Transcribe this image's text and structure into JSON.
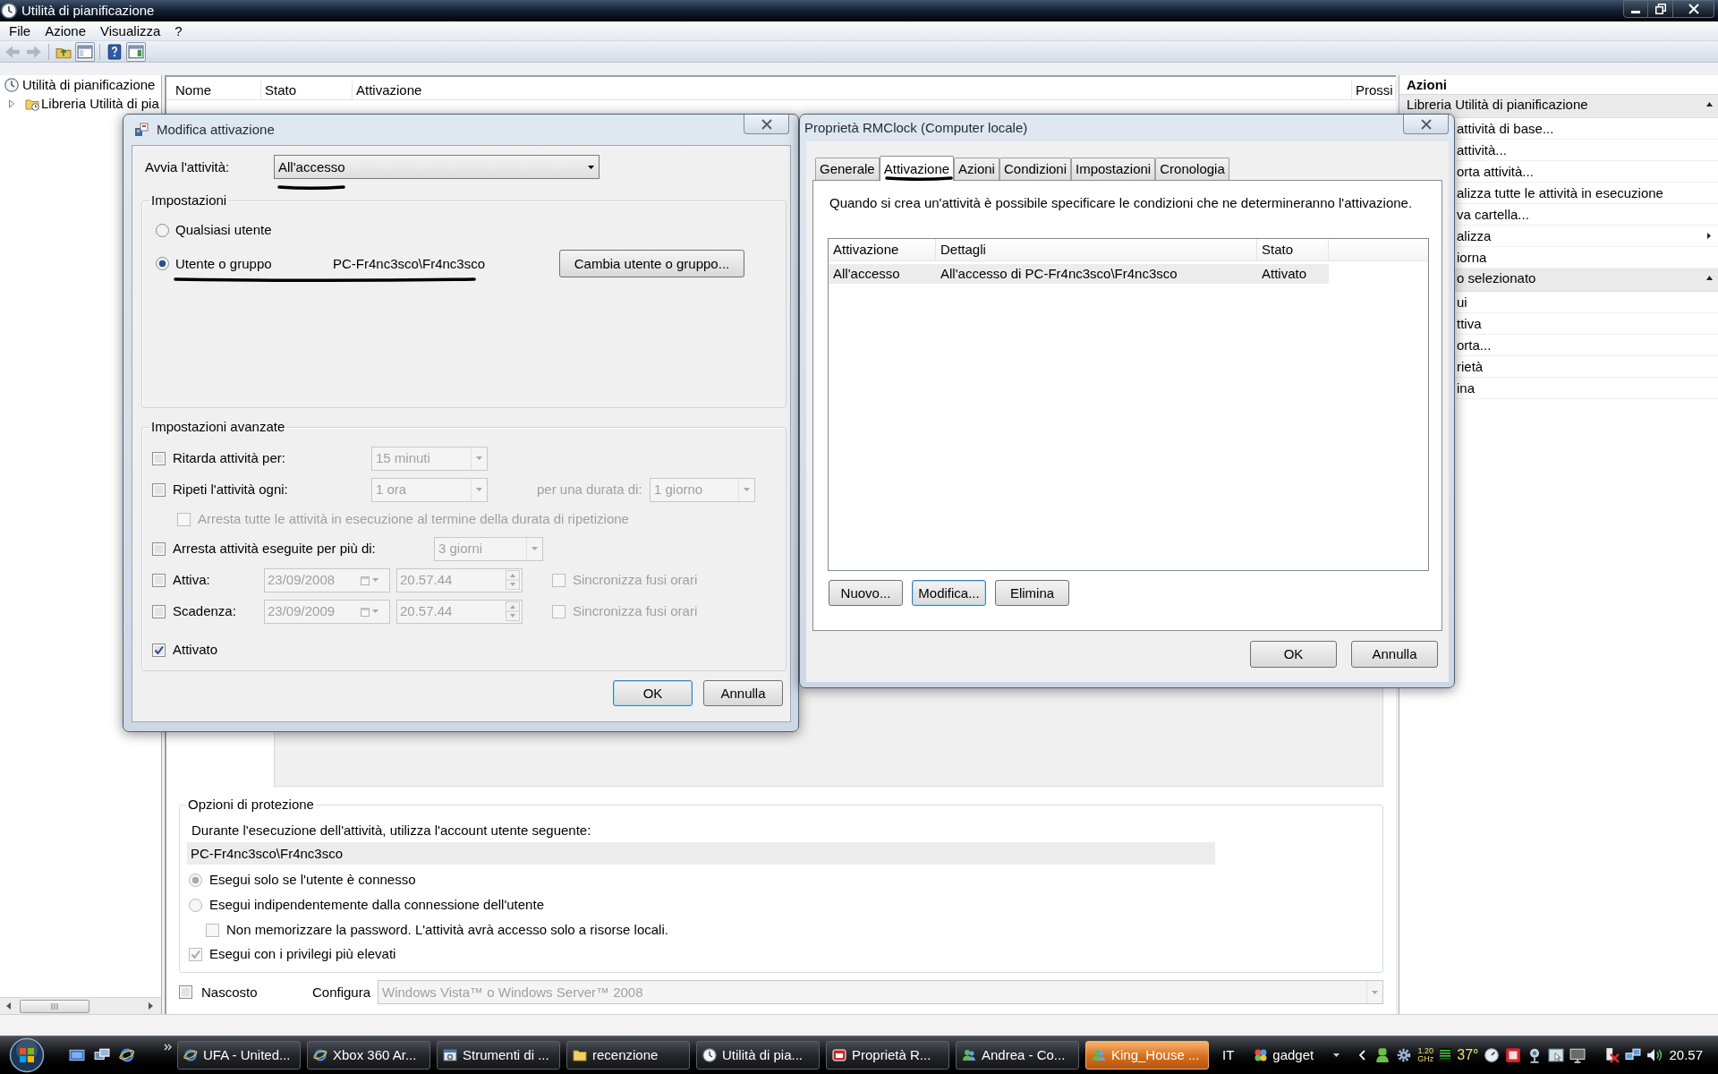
{
  "window": {
    "title": "Utilità di pianificazione"
  },
  "menu": [
    {
      "label": "File"
    },
    {
      "label": "Azione"
    },
    {
      "label": "Visualizza"
    },
    {
      "label": "?"
    }
  ],
  "toolbar": [
    {
      "kind": "back",
      "disabled": true
    },
    {
      "kind": "forward",
      "disabled": true
    },
    {
      "kind": "up",
      "disabled": false
    },
    {
      "kind": "tree",
      "disabled": false
    },
    {
      "kind": "help",
      "disabled": false
    },
    {
      "kind": "pane",
      "disabled": false
    }
  ],
  "tree": [
    {
      "label": "Utilità di pianificazione",
      "children": [
        {
          "label": "Libreria Utilità di pia",
          "expanded": false
        }
      ]
    }
  ],
  "task_list": {
    "columns": [
      "Nome",
      "Stato",
      "Attivazione",
      "Prossi"
    ]
  },
  "protection": {
    "title": "Opzioni di protezione",
    "account_label": "Durante l'esecuzione dell'attività, utilizza l'account utente seguente:",
    "account": "PC-Fr4nc3sco\\Fr4nc3sco",
    "options": [
      {
        "kind": "radio",
        "label": "Esegui solo se l'utente è connesso",
        "selected": true
      },
      {
        "kind": "radio",
        "label": "Esegui indipendentemente dalla connessione dell'utente",
        "selected": false,
        "children": [
          {
            "kind": "checkbox",
            "label": "Non memorizzare la password. L'attività avrà accesso solo a risorse locali.",
            "checked": false
          }
        ]
      },
      {
        "kind": "checkbox",
        "label": "Esegui con i privilegi più elevati",
        "checked": true
      }
    ]
  },
  "task_options": {
    "hidden": {
      "label": "Nascosto",
      "checked": false
    },
    "configure": {
      "label": "Configura",
      "value": "Windows Vista™ o Windows Server™ 2008",
      "disabled": true
    }
  },
  "actions_panel": {
    "title": "Azioni",
    "sections": [
      {
        "title": "Libreria Utilità di pianificazione",
        "expanded": true,
        "items": [
          {
            "label": "attività di base...",
            "submenu": false
          },
          {
            "label": "attività...",
            "submenu": false
          },
          {
            "label": "orta attività...",
            "submenu": false
          },
          {
            "label": "alizza tutte le attività in esecuzione",
            "submenu": false
          },
          {
            "label": "va cartella...",
            "submenu": false
          },
          {
            "label": "alizza",
            "submenu": true
          },
          {
            "label": "iorna",
            "submenu": false
          }
        ]
      },
      {
        "title": "o selezionato",
        "expanded": true,
        "items": [
          {
            "label": "ui",
            "submenu": false
          },
          {
            "label": "ttiva",
            "submenu": false
          },
          {
            "label": "orta...",
            "submenu": false
          },
          {
            "label": "rietà",
            "submenu": false
          },
          {
            "label": "ina",
            "submenu": false
          }
        ]
      }
    ]
  },
  "edit_trigger_dialog": {
    "title": "Modifica attivazione",
    "start_label": "Avvia l'attività:",
    "start_value": "All'accesso",
    "settings": {
      "title": "Impostazioni",
      "options": [
        {
          "label": "Qualsiasi utente",
          "selected": false
        },
        {
          "label": "Utente o gruppo",
          "value": "PC-Fr4nc3sco\\Fr4nc3sco",
          "selected": true
        }
      ],
      "change_button": "Cambia utente o gruppo..."
    },
    "advanced": {
      "title": "Impostazioni avanzate",
      "rows": [
        {
          "kind": "delay",
          "label": "Ritarda attività per:",
          "checked": false,
          "value": "15 minuti"
        },
        {
          "kind": "repeat",
          "label": "Ripeti l'attività ogni:",
          "checked": false,
          "value": "1 ora",
          "duration_label": "per una durata di:",
          "duration_value": "1 giorno",
          "children": [
            {
              "label": "Arresta tutte le attività in esecuzione al termine della durata di ripetizione",
              "checked": false
            }
          ]
        },
        {
          "kind": "stop",
          "label": "Arresta attività eseguite per più di:",
          "checked": false,
          "value": "3 giorni"
        },
        {
          "kind": "date",
          "label": "Attiva:",
          "checked": false,
          "date": "23/09/2008",
          "time": "20.57.44",
          "sync_label": "Sincronizza fusi orari",
          "sync_checked": false
        },
        {
          "kind": "date",
          "label": "Scadenza:",
          "checked": false,
          "date": "23/09/2009",
          "time": "20.57.44",
          "sync_label": "Sincronizza fusi orari",
          "sync_checked": false
        },
        {
          "kind": "flag",
          "label": "Attivato",
          "checked": true
        }
      ]
    },
    "buttons": [
      {
        "label": "OK",
        "default": true
      },
      {
        "label": "Annulla",
        "default": false
      }
    ]
  },
  "properties_dialog": {
    "title": "Proprietà RMClock (Computer locale)",
    "tabs": [
      {
        "label": "Generale",
        "selected": false
      },
      {
        "label": "Attivazione",
        "selected": true
      },
      {
        "label": "Azioni",
        "selected": false
      },
      {
        "label": "Condizioni",
        "selected": false
      },
      {
        "label": "Impostazioni",
        "selected": false
      },
      {
        "label": "Cronologia",
        "selected": false
      }
    ],
    "description": "Quando si crea un'attività è possibile specificare le condizioni che ne determineranno l'attivazione.",
    "table": {
      "columns": [
        "Attivazione",
        "Dettagli",
        "Stato"
      ],
      "rows": [
        {
          "cells": [
            "All'accesso",
            "All'accesso di PC-Fr4nc3sco\\Fr4nc3sco",
            "Attivato"
          ],
          "selected": true
        }
      ]
    },
    "list_buttons": [
      {
        "label": "Nuovo...",
        "focused": false
      },
      {
        "label": "Modifica...",
        "focused": true
      },
      {
        "label": "Elimina",
        "focused": false
      }
    ],
    "buttons": [
      {
        "label": "OK"
      },
      {
        "label": "Annulla"
      }
    ]
  },
  "taskbar": {
    "tasks": [
      {
        "kind": "browser",
        "label": "UFA - United...",
        "selected": false,
        "flashing": false
      },
      {
        "kind": "browser",
        "label": "Xbox 360 Ar...",
        "selected": false,
        "flashing": false
      },
      {
        "kind": "tools",
        "label": "Strumenti di ...",
        "selected": false,
        "flashing": false
      },
      {
        "kind": "folder",
        "label": "recenzione",
        "selected": false,
        "flashing": false
      },
      {
        "kind": "clock",
        "label": "Utilità di pia...",
        "selected": false,
        "flashing": false
      },
      {
        "kind": "app",
        "label": "Proprietà R...",
        "selected": false,
        "flashing": false
      },
      {
        "kind": "messenger",
        "label": "Andrea - Co...",
        "selected": false,
        "flashing": false
      },
      {
        "kind": "messenger",
        "label": "King_House ...",
        "selected": false,
        "flashing": true
      }
    ],
    "language": "IT",
    "toolbar_label": "gadget",
    "cpu_speed": "1.20",
    "cpu_unit": "GHz",
    "temperature": "37°",
    "clock": "20.57"
  }
}
